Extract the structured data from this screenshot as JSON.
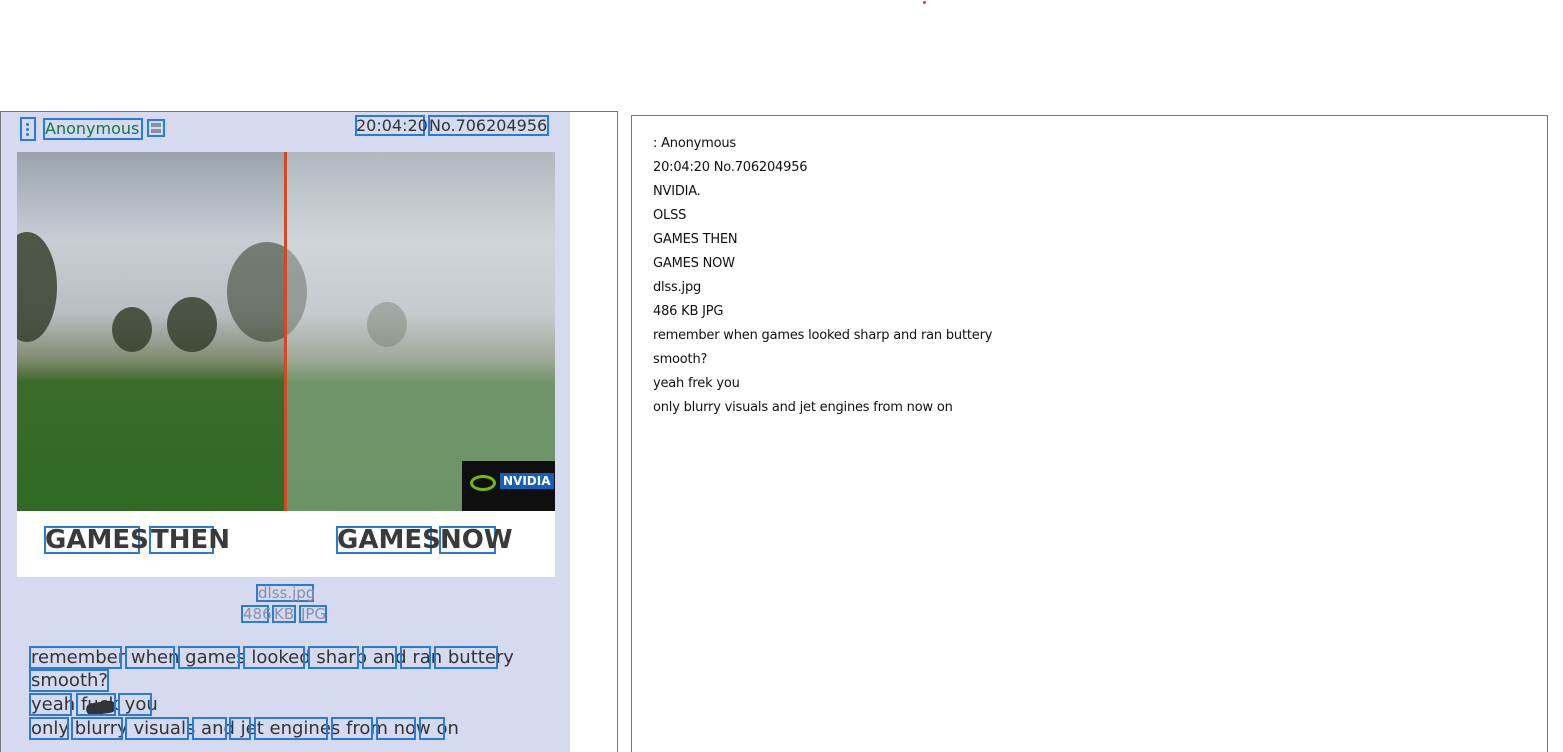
{
  "post": {
    "name": "Anonymous",
    "time": "20:04:20",
    "post_no": "No.706204956",
    "image_captions": {
      "left_word1": "GAMES",
      "left_word2": "THEN",
      "right_word1": "GAMES",
      "right_word2": "NOW"
    },
    "logo_text": "NVIDIA",
    "file_name": "dlss.jpg",
    "file_size_num": "486",
    "file_size_unit": "KB",
    "file_type": "JPG",
    "lines": [
      "remember when games looked sharp and ran buttery",
      "smooth?",
      "yeah fuck you",
      "only blurry visuals and jet engines from now on"
    ]
  },
  "ocr_text": [
    ": Anonymous",
    "20:04:20 No.706204956",
    "NVIDIA.",
    "OLSS",
    "GAMES THEN",
    "GAMES NOW",
    "dlss.jpg",
    "486 KB JPG",
    "remember when games looked sharp and ran buttery",
    "smooth?",
    "yeah frek you",
    "only blurry visuals and jet engines from now on"
  ],
  "colors": {
    "post_bg": "#d6daf0",
    "box_stroke": "#2a7bd6",
    "name_green": "#117743",
    "nvidia_green": "#76b900"
  }
}
